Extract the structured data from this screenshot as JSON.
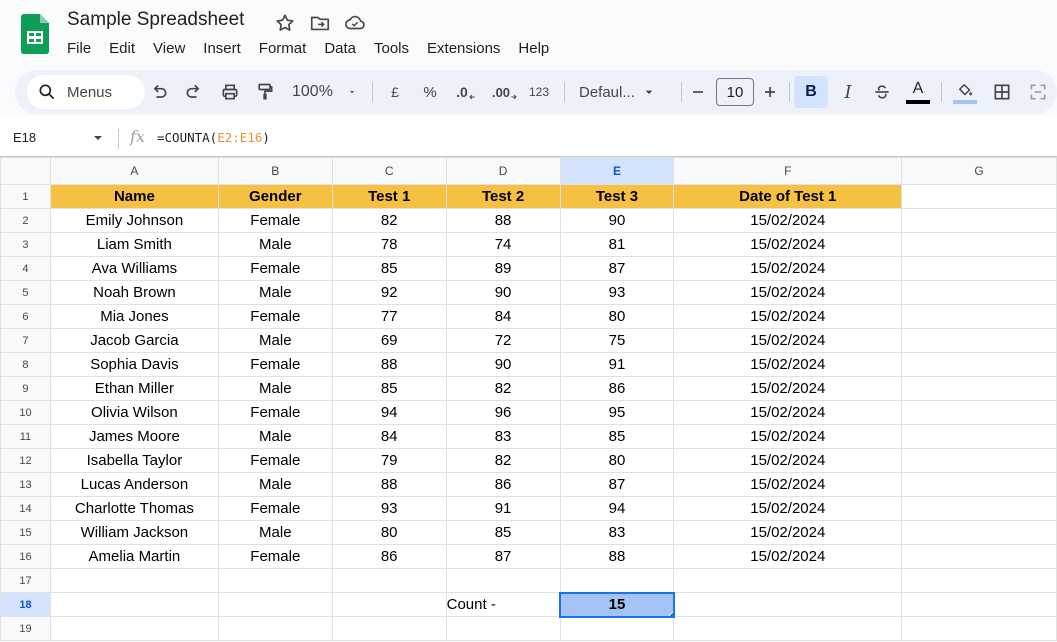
{
  "app": {
    "title": "Sample Spreadsheet",
    "brand_color": "#0f9d58",
    "menu": [
      "File",
      "Edit",
      "View",
      "Insert",
      "Format",
      "Data",
      "Tools",
      "Extensions",
      "Help"
    ]
  },
  "toolbar": {
    "search_label": "Menus",
    "zoom": "100%",
    "currency": "£",
    "percent": "%",
    "decrease_decimal": ".0",
    "increase_decimal": ".00",
    "number_format": "123",
    "font": "Defaul...",
    "font_size": "10",
    "bold": "B",
    "italic": "I",
    "text_color": "A"
  },
  "formula_bar": {
    "name_box": "E18",
    "fx": "fx",
    "formula_prefix": "=COUNTA(",
    "formula_ref": "E2:E16",
    "formula_suffix": ")"
  },
  "sheet": {
    "selected_cell": "E18",
    "header_fill": "#f6c142",
    "selection_fill": "#a4c2f4",
    "columns": [
      "A",
      "B",
      "C",
      "D",
      "E",
      "F",
      "G"
    ],
    "headers": [
      "Name",
      "Gender",
      "Test 1",
      "Test 2",
      "Test 3",
      "Date of Test 1"
    ],
    "rows": [
      [
        "Emily Johnson",
        "Female",
        "82",
        "88",
        "90",
        "15/02/2024"
      ],
      [
        "Liam Smith",
        "Male",
        "78",
        "74",
        "81",
        "15/02/2024"
      ],
      [
        "Ava Williams",
        "Female",
        "85",
        "89",
        "87",
        "15/02/2024"
      ],
      [
        "Noah Brown",
        "Male",
        "92",
        "90",
        "93",
        "15/02/2024"
      ],
      [
        "Mia Jones",
        "Female",
        "77",
        "84",
        "80",
        "15/02/2024"
      ],
      [
        "Jacob Garcia",
        "Male",
        "69",
        "72",
        "75",
        "15/02/2024"
      ],
      [
        "Sophia Davis",
        "Female",
        "88",
        "90",
        "91",
        "15/02/2024"
      ],
      [
        "Ethan Miller",
        "Male",
        "85",
        "82",
        "86",
        "15/02/2024"
      ],
      [
        "Olivia Wilson",
        "Female",
        "94",
        "96",
        "95",
        "15/02/2024"
      ],
      [
        "James Moore",
        "Male",
        "84",
        "83",
        "85",
        "15/02/2024"
      ],
      [
        "Isabella Taylor",
        "Female",
        "79",
        "82",
        "80",
        "15/02/2024"
      ],
      [
        "Lucas Anderson",
        "Male",
        "88",
        "86",
        "87",
        "15/02/2024"
      ],
      [
        "Charlotte Thomas",
        "Female",
        "93",
        "91",
        "94",
        "15/02/2024"
      ],
      [
        "William Jackson",
        "Male",
        "80",
        "85",
        "83",
        "15/02/2024"
      ],
      [
        "Amelia Martin",
        "Female",
        "86",
        "87",
        "88",
        "15/02/2024"
      ]
    ],
    "row_numbers": [
      "1",
      "2",
      "3",
      "4",
      "5",
      "6",
      "7",
      "8",
      "9",
      "10",
      "11",
      "12",
      "13",
      "14",
      "15",
      "16",
      "17",
      "18",
      "19"
    ],
    "count_label": "Count -",
    "count_value": "15"
  }
}
